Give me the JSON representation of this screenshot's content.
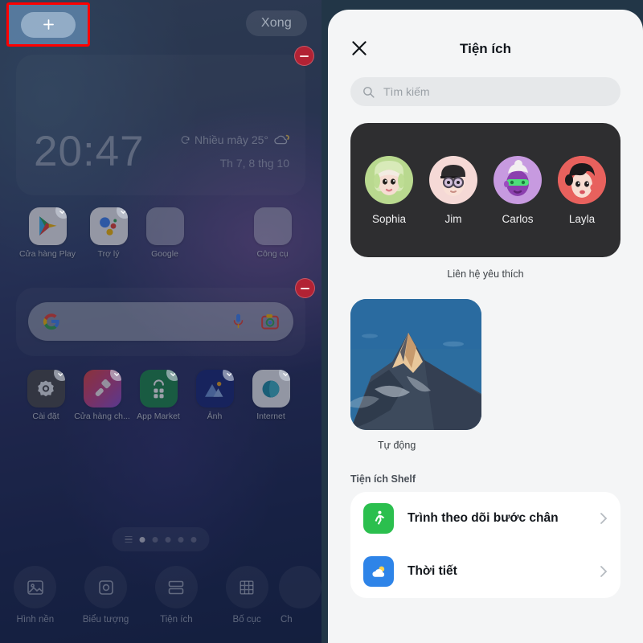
{
  "home": {
    "topbar": {
      "add_label": "+",
      "done_label": "Xong"
    },
    "clock_widget": {
      "time": "20:47",
      "weather": "Nhiều mây 25°",
      "date": "Th 7, 8 thg 10",
      "remove_label": "−"
    },
    "search_widget": {
      "remove_label": "−",
      "brand": "G"
    },
    "apps_row1": [
      {
        "label": "Cửa hàng Play",
        "icon": "play-store-icon",
        "selected": true
      },
      {
        "label": "Trợ lý",
        "icon": "google-assistant-icon",
        "selected": true
      },
      {
        "label": "Google",
        "icon": "google-folder-icon",
        "selected": false
      },
      {
        "label": "Công cụ",
        "icon": "tools-folder-icon",
        "selected": false
      }
    ],
    "apps_row2": [
      {
        "label": "Cài đặt",
        "icon": "settings-icon",
        "selected": true
      },
      {
        "label": "Cửa hàng ch...",
        "icon": "theme-store-icon",
        "selected": true
      },
      {
        "label": "App Market",
        "icon": "app-market-icon",
        "selected": true
      },
      {
        "label": "Ảnh",
        "icon": "photos-icon",
        "selected": true
      },
      {
        "label": "Internet",
        "icon": "internet-icon",
        "selected": true
      }
    ],
    "page_indicator": {
      "pages": 5,
      "active": 1
    },
    "tools": [
      {
        "label": "Hình nền",
        "icon": "wallpaper-icon"
      },
      {
        "label": "Biểu tượng",
        "icon": "icon-style-icon"
      },
      {
        "label": "Tiện ích",
        "icon": "widgets-icon"
      },
      {
        "label": "Bố cục",
        "icon": "layout-grid-icon"
      },
      {
        "label": "Ch",
        "icon": "more-icon"
      }
    ]
  },
  "sheet": {
    "title": "Tiện ích",
    "close_label": "✕",
    "search": {
      "placeholder": "Tìm kiếm",
      "value": ""
    },
    "contacts": {
      "caption": "Liên hệ yêu thích",
      "people": [
        {
          "name": "Sophia",
          "bg": "#b9d98f"
        },
        {
          "name": "Jim",
          "bg": "#f5d9d6"
        },
        {
          "name": "Carlos",
          "bg": "#c79ae0"
        },
        {
          "name": "Layla",
          "bg": "#e8615d"
        }
      ]
    },
    "auto_widget": {
      "caption": "Tự động"
    },
    "shelf_section": {
      "label": "Tiện ích Shelf",
      "items": [
        {
          "title": "Trình theo dõi bước chân",
          "icon": "step-tracker-icon",
          "color": "#2bbf4e"
        },
        {
          "title": "Thời tiết",
          "icon": "weather-icon",
          "color": "#2e84e8"
        }
      ]
    }
  }
}
